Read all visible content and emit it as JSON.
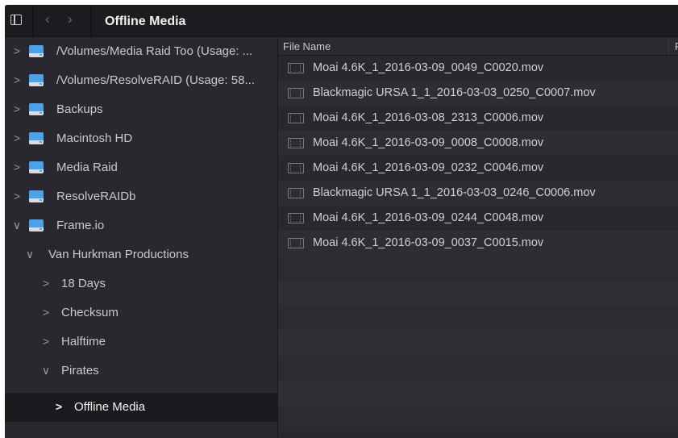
{
  "titlebar": {
    "title": "Offline Media",
    "back_glyph": "‹",
    "forward_glyph": "›"
  },
  "sidebar": {
    "items": [
      {
        "label": "/Volumes/Media Raid Too (Usage: ...",
        "expanded": false,
        "icon": "drive-icon",
        "depth": 0
      },
      {
        "label": "/Volumes/ResolveRAID (Usage: 58...",
        "expanded": false,
        "icon": "drive-icon",
        "depth": 0
      },
      {
        "label": "Backups",
        "expanded": false,
        "icon": "drive-icon",
        "depth": 0
      },
      {
        "label": "Macintosh HD",
        "expanded": false,
        "icon": "drive-icon",
        "depth": 0
      },
      {
        "label": "Media Raid",
        "expanded": false,
        "icon": "drive-icon",
        "depth": 0
      },
      {
        "label": "ResolveRAIDb",
        "expanded": false,
        "icon": "drive-icon",
        "depth": 0
      },
      {
        "label": "Frame.io",
        "expanded": true,
        "icon": "drive-icon",
        "depth": 0
      },
      {
        "label": "Van Hurkman Productions",
        "expanded": true,
        "depth": 1
      },
      {
        "label": "18 Days",
        "expanded": false,
        "depth": 2
      },
      {
        "label": "Checksum",
        "expanded": false,
        "depth": 2
      },
      {
        "label": "Halftime",
        "expanded": false,
        "depth": 2
      },
      {
        "label": "Pirates",
        "expanded": true,
        "depth": 2
      },
      {
        "label": "Offline Media",
        "expanded": false,
        "depth": 3,
        "selected": true
      }
    ]
  },
  "filelist": {
    "column_header": "File Name",
    "next_column_header": "F",
    "files": [
      "Moai 4.6K_1_2016-03-09_0049_C0020.mov",
      "Blackmagic URSA 1_1_2016-03-03_0250_C0007.mov",
      "Moai 4.6K_1_2016-03-08_2313_C0006.mov",
      "Moai 4.6K_1_2016-03-09_0008_C0008.mov",
      "Moai 4.6K_1_2016-03-09_0232_C0046.mov",
      "Blackmagic URSA 1_1_2016-03-03_0246_C0006.mov",
      "Moai 4.6K_1_2016-03-09_0244_C0048.mov",
      "Moai 4.6K_1_2016-03-09_0037_C0015.mov"
    ]
  },
  "colors": {
    "window_bg": "#28282e",
    "titlebar_bg": "#1c1c20",
    "selected_bg": "#1b1b1f",
    "drive_blue": "#4aa3e8"
  }
}
